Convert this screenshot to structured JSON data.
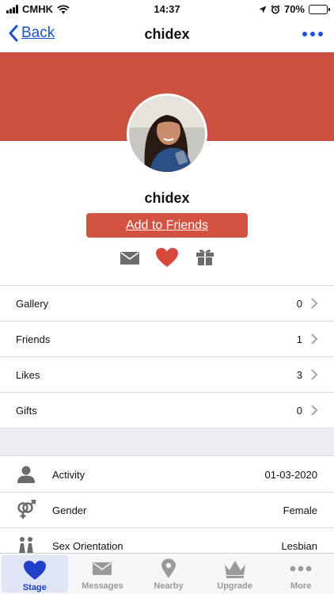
{
  "status": {
    "carrier": "CMHK",
    "time": "14:37",
    "battery": "70%",
    "battery_level": 0.7
  },
  "nav": {
    "back_label": "Back",
    "title": "chidex"
  },
  "profile": {
    "username": "chidex",
    "add_friend_label": "Add to Friends"
  },
  "stats": [
    {
      "label": "Gallery",
      "value": "0"
    },
    {
      "label": "Friends",
      "value": "1"
    },
    {
      "label": "Likes",
      "value": "3"
    },
    {
      "label": "Gifts",
      "value": "0"
    }
  ],
  "details": [
    {
      "icon": "person-icon",
      "label": "Activity",
      "value": "01-03-2020"
    },
    {
      "icon": "gender-icon",
      "label": "Gender",
      "value": "Female"
    },
    {
      "icon": "couple-icon",
      "label": "Sex Orientation",
      "value": "Lesbian"
    }
  ],
  "tabs": [
    {
      "icon": "heart-icon",
      "label": "Stage",
      "active": true
    },
    {
      "icon": "envelope-icon",
      "label": "Messages",
      "active": false
    },
    {
      "icon": "location-pin-icon",
      "label": "Nearby",
      "active": false
    },
    {
      "icon": "crown-icon",
      "label": "Upgrade",
      "active": false
    },
    {
      "icon": "ellipsis-icon",
      "label": "More",
      "active": false
    }
  ],
  "colors": {
    "accent": "#1f4fd6",
    "banner": "#cb5240",
    "button": "#d45242",
    "heart": "#d5493c"
  }
}
